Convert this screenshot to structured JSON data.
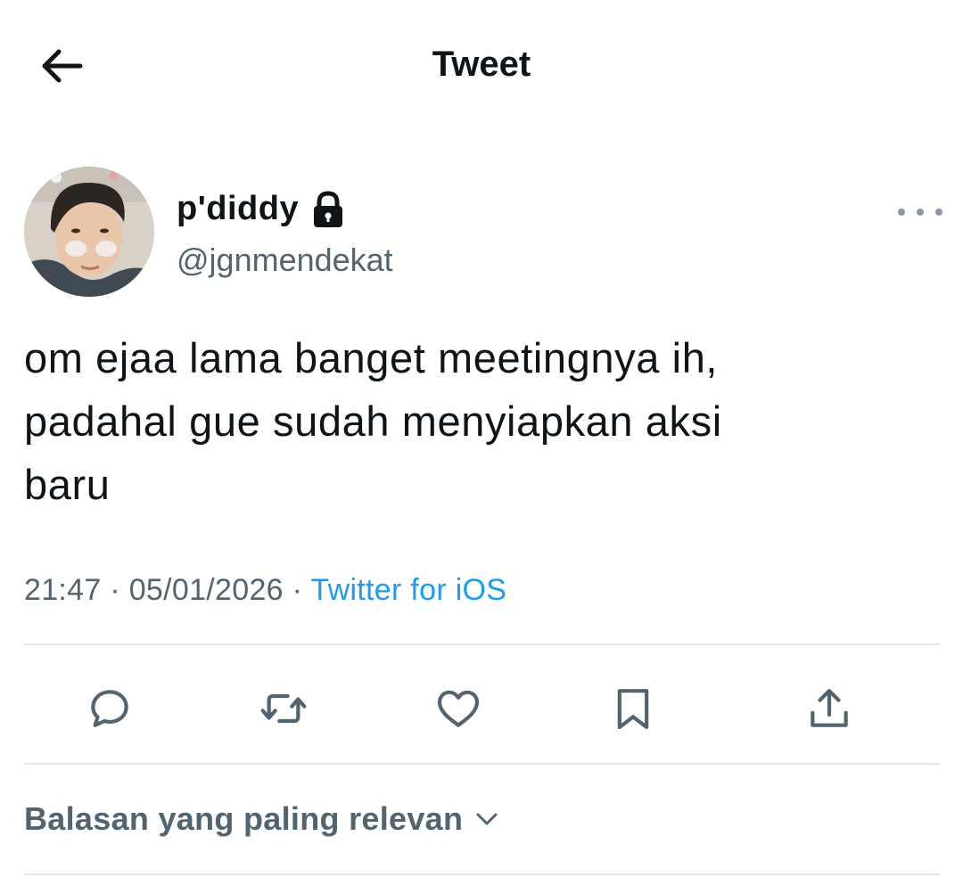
{
  "header": {
    "title": "Tweet",
    "back_icon": "arrow-left-icon"
  },
  "author": {
    "display_name": "p'diddy",
    "handle": "@jgnmendekat",
    "protected_icon": "lock-icon",
    "more_icon": "more-horizontal-icon"
  },
  "tweet": {
    "text_lines": [
      "om ejaa lama banget meetingnya ih,",
      "padahal gue sudah menyiapkan aksi",
      "baru"
    ],
    "time": "21:47",
    "separator": "·",
    "date": "05/01/2026",
    "source": "Twitter for iOS"
  },
  "actions": {
    "reply_icon": "reply-icon",
    "retweet_icon": "retweet-icon",
    "like_icon": "heart-icon",
    "bookmark_icon": "bookmark-icon",
    "share_icon": "share-icon"
  },
  "replies": {
    "sort_label": "Balasan yang paling relevan",
    "chevron_icon": "chevron-down-icon"
  },
  "colors": {
    "text": "#0f1419",
    "secondary": "#536471",
    "link": "#1d9bf0",
    "divider": "#e1e6ea"
  }
}
